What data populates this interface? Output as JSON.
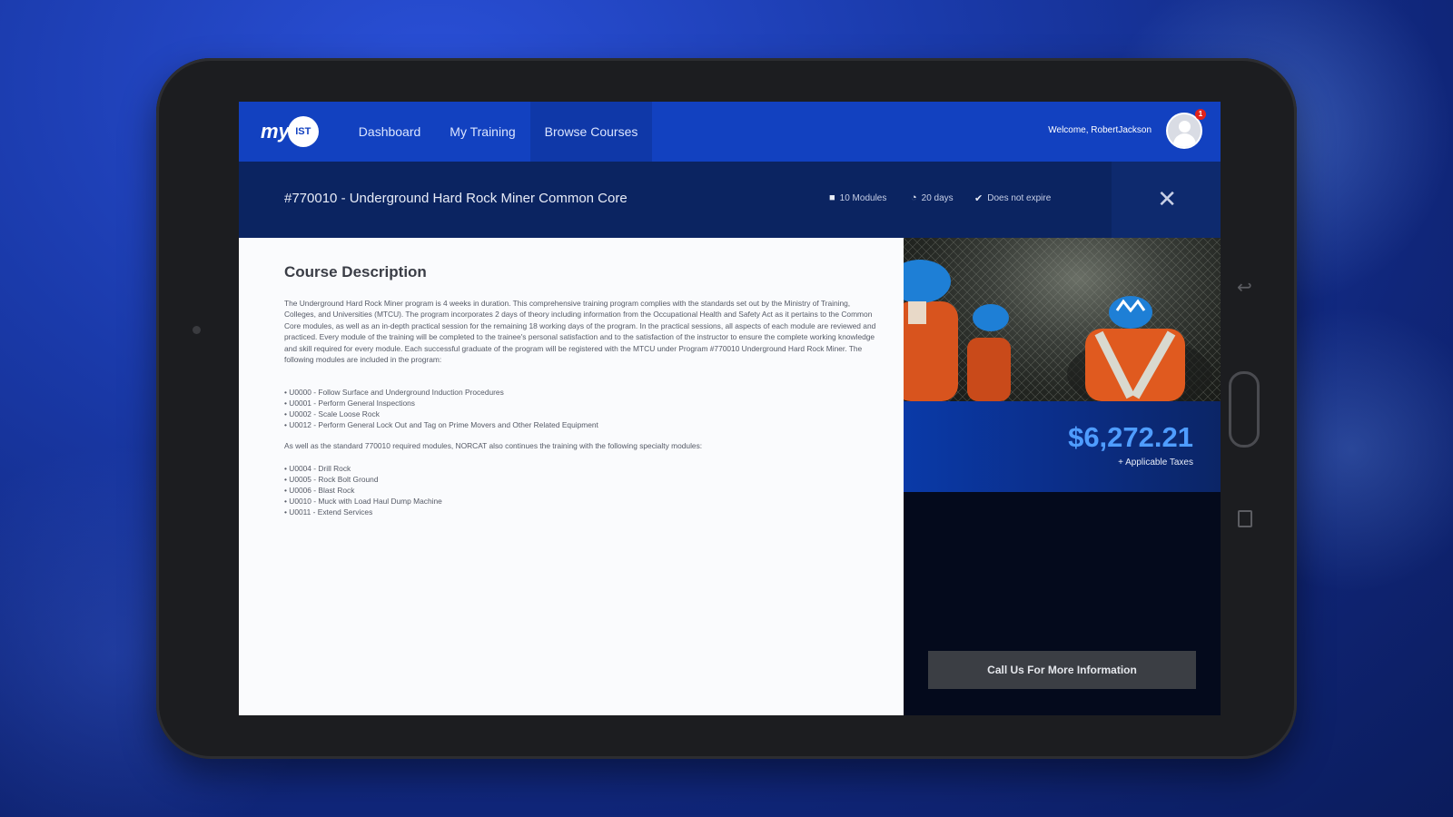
{
  "app": {
    "logo_text": "my",
    "logo_badge": "IST"
  },
  "nav": {
    "items": [
      {
        "label": "Dashboard"
      },
      {
        "label": "My Training"
      },
      {
        "label": "Browse Courses"
      }
    ],
    "active": "Browse Courses"
  },
  "user": {
    "welcome_text": "Welcome, RobertJackson",
    "notification_count": "1"
  },
  "course": {
    "title": "#770010 - Underground Hard Rock Miner Common Core",
    "modules": "10 Modules",
    "duration": "20 days",
    "expiry": "Does not expire"
  },
  "content": {
    "section_title": "Course Description",
    "description": "The Underground Hard Rock Miner program is 4 weeks in duration. This comprehensive training program complies with the standards set out by the Ministry of Training, Colleges, and Universities (MTCU). The program incorporates 2 days of theory including information from the Occupational Health and Safety Act as it pertains to the Common Core modules, as well as an in-depth practical session for the remaining 18 working days of the program. In the practical sessions, all aspects of each module are reviewed and practiced. Every module of the training will be completed to the trainee's personal satisfaction and to the satisfaction of the instructor to ensure the complete working knowledge and skill required for every module. Each successful graduate of the program will be registered with the MTCU under Program #770010 Underground Hard Rock Miner. The following modules are included in the program:",
    "modules_list": [
      "U0000 - Follow Surface and Underground Induction Procedures",
      "U0001 - Perform General Inspections",
      "U0002 - Scale Loose Rock",
      "U0012 - Perform General Lock Out and Tag on Prime Movers and Other Related Equipment"
    ],
    "intro2": "As well as the standard 770010 required modules, NORCAT also continues the training with the following specialty modules:",
    "specialty_list": [
      "U0004 - Drill Rock",
      "U0005 - Rock Bolt Ground",
      "U0006 - Blast Rock",
      "U0010 - Muck with Load Haul Dump Machine",
      "U0011 - Extend Services"
    ]
  },
  "pricing": {
    "price": "$6,272.21",
    "tax_note": "+ Applicable Taxes",
    "cta_label": "Call Us For More Information"
  },
  "colors": {
    "nav_bg": "#1241c0",
    "header_bg": "#0b2461",
    "price": "#4f9dff"
  }
}
